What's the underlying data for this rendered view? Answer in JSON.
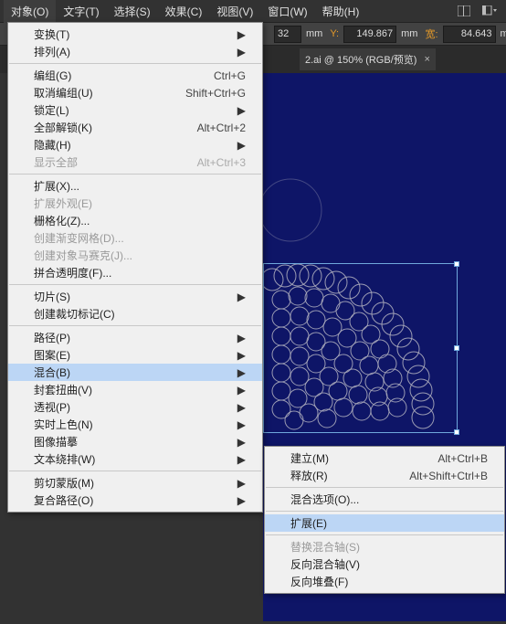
{
  "menubar": {
    "items": [
      {
        "label": "对象(O)",
        "active": true
      },
      {
        "label": "文字(T)"
      },
      {
        "label": "选择(S)"
      },
      {
        "label": "效果(C)"
      },
      {
        "label": "视图(V)"
      },
      {
        "label": "窗口(W)"
      },
      {
        "label": "帮助(H)"
      }
    ]
  },
  "options": {
    "x_suffix": "32",
    "x_unit": "mm",
    "y_label": "Y:",
    "y_value": "149.867",
    "y_unit": "mm",
    "w_label": "宽:",
    "w_value": "84.643",
    "w_unit": "mm"
  },
  "tabs": {
    "file": "2.ai @ 150% (RGB/预览)",
    "close": "×"
  },
  "menu1": {
    "groups": [
      [
        {
          "label": "变换(T)",
          "submenu": true
        },
        {
          "label": "排列(A)",
          "submenu": true
        }
      ],
      [
        {
          "label": "编组(G)",
          "shortcut": "Ctrl+G"
        },
        {
          "label": "取消编组(U)",
          "shortcut": "Shift+Ctrl+G"
        },
        {
          "label": "锁定(L)",
          "submenu": true
        },
        {
          "label": "全部解锁(K)",
          "shortcut": "Alt+Ctrl+2"
        },
        {
          "label": "隐藏(H)",
          "submenu": true
        },
        {
          "label": "显示全部",
          "shortcut": "Alt+Ctrl+3",
          "disabled": true
        }
      ],
      [
        {
          "label": "扩展(X)..."
        },
        {
          "label": "扩展外观(E)",
          "disabled": true
        },
        {
          "label": "栅格化(Z)..."
        },
        {
          "label": "创建渐变网格(D)...",
          "disabled": true
        },
        {
          "label": "创建对象马赛克(J)...",
          "disabled": true
        },
        {
          "label": "拼合透明度(F)..."
        }
      ],
      [
        {
          "label": "切片(S)",
          "submenu": true
        },
        {
          "label": "创建裁切标记(C)"
        }
      ],
      [
        {
          "label": "路径(P)",
          "submenu": true
        },
        {
          "label": "图案(E)",
          "submenu": true
        },
        {
          "label": "混合(B)",
          "submenu": true,
          "hover": true
        },
        {
          "label": "封套扭曲(V)",
          "submenu": true
        },
        {
          "label": "透视(P)",
          "submenu": true
        },
        {
          "label": "实时上色(N)",
          "submenu": true
        },
        {
          "label": "图像描摹",
          "submenu": true
        },
        {
          "label": "文本绕排(W)",
          "submenu": true
        }
      ],
      [
        {
          "label": "剪切蒙版(M)",
          "submenu": true
        },
        {
          "label": "复合路径(O)",
          "submenu": true
        }
      ]
    ]
  },
  "menu2": {
    "groups": [
      [
        {
          "label": "建立(M)",
          "shortcut": "Alt+Ctrl+B"
        },
        {
          "label": "释放(R)",
          "shortcut": "Alt+Shift+Ctrl+B"
        }
      ],
      [
        {
          "label": "混合选项(O)..."
        }
      ],
      [
        {
          "label": "扩展(E)",
          "hover": true
        }
      ],
      [
        {
          "label": "替换混合轴(S)",
          "disabled": true
        },
        {
          "label": "反向混合轴(V)"
        },
        {
          "label": "反向堆叠(F)"
        }
      ]
    ]
  }
}
